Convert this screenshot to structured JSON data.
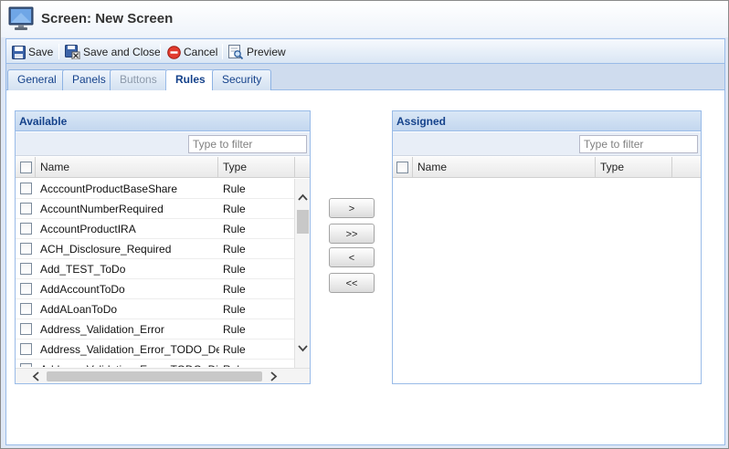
{
  "window": {
    "title": "Screen: New Screen"
  },
  "toolbar": {
    "save": "Save",
    "save_close": "Save and Close",
    "cancel": "Cancel",
    "preview": "Preview"
  },
  "tabs": [
    {
      "label": "General",
      "state": "normal"
    },
    {
      "label": "Panels",
      "state": "normal"
    },
    {
      "label": "Buttons",
      "state": "disabled"
    },
    {
      "label": "Rules",
      "state": "active"
    },
    {
      "label": "Security",
      "state": "normal"
    }
  ],
  "available": {
    "title": "Available",
    "filter_placeholder": "Type to filter",
    "col_name": "Name",
    "col_type": "Type",
    "rows": [
      {
        "name": "AcccountProductBaseShare",
        "type": "Rule"
      },
      {
        "name": "AccountNumberRequired",
        "type": "Rule"
      },
      {
        "name": "AccountProductIRA",
        "type": "Rule"
      },
      {
        "name": "ACH_Disclosure_Required",
        "type": "Rule"
      },
      {
        "name": "Add_TEST_ToDo",
        "type": "Rule"
      },
      {
        "name": "AddAccountToDo",
        "type": "Rule"
      },
      {
        "name": "AddALoanToDo",
        "type": "Rule"
      },
      {
        "name": "Address_Validation_Error",
        "type": "Rule"
      },
      {
        "name": "Address_Validation_Error_TODO_Dec",
        "type": "Rule"
      },
      {
        "name": "Address_Validation_Error_TODO_Dish",
        "type": "Rule"
      }
    ]
  },
  "assigned": {
    "title": "Assigned",
    "filter_placeholder": "Type to filter",
    "col_name": "Name",
    "col_type": "Type",
    "rows": []
  },
  "move_buttons": {
    "add_one": ">",
    "add_all": ">>",
    "remove_one": "<",
    "remove_all": "<<"
  },
  "colors": {
    "header_text": "#15428b",
    "border": "#99bbe8",
    "chrome_bg": "#dfe8f6"
  }
}
